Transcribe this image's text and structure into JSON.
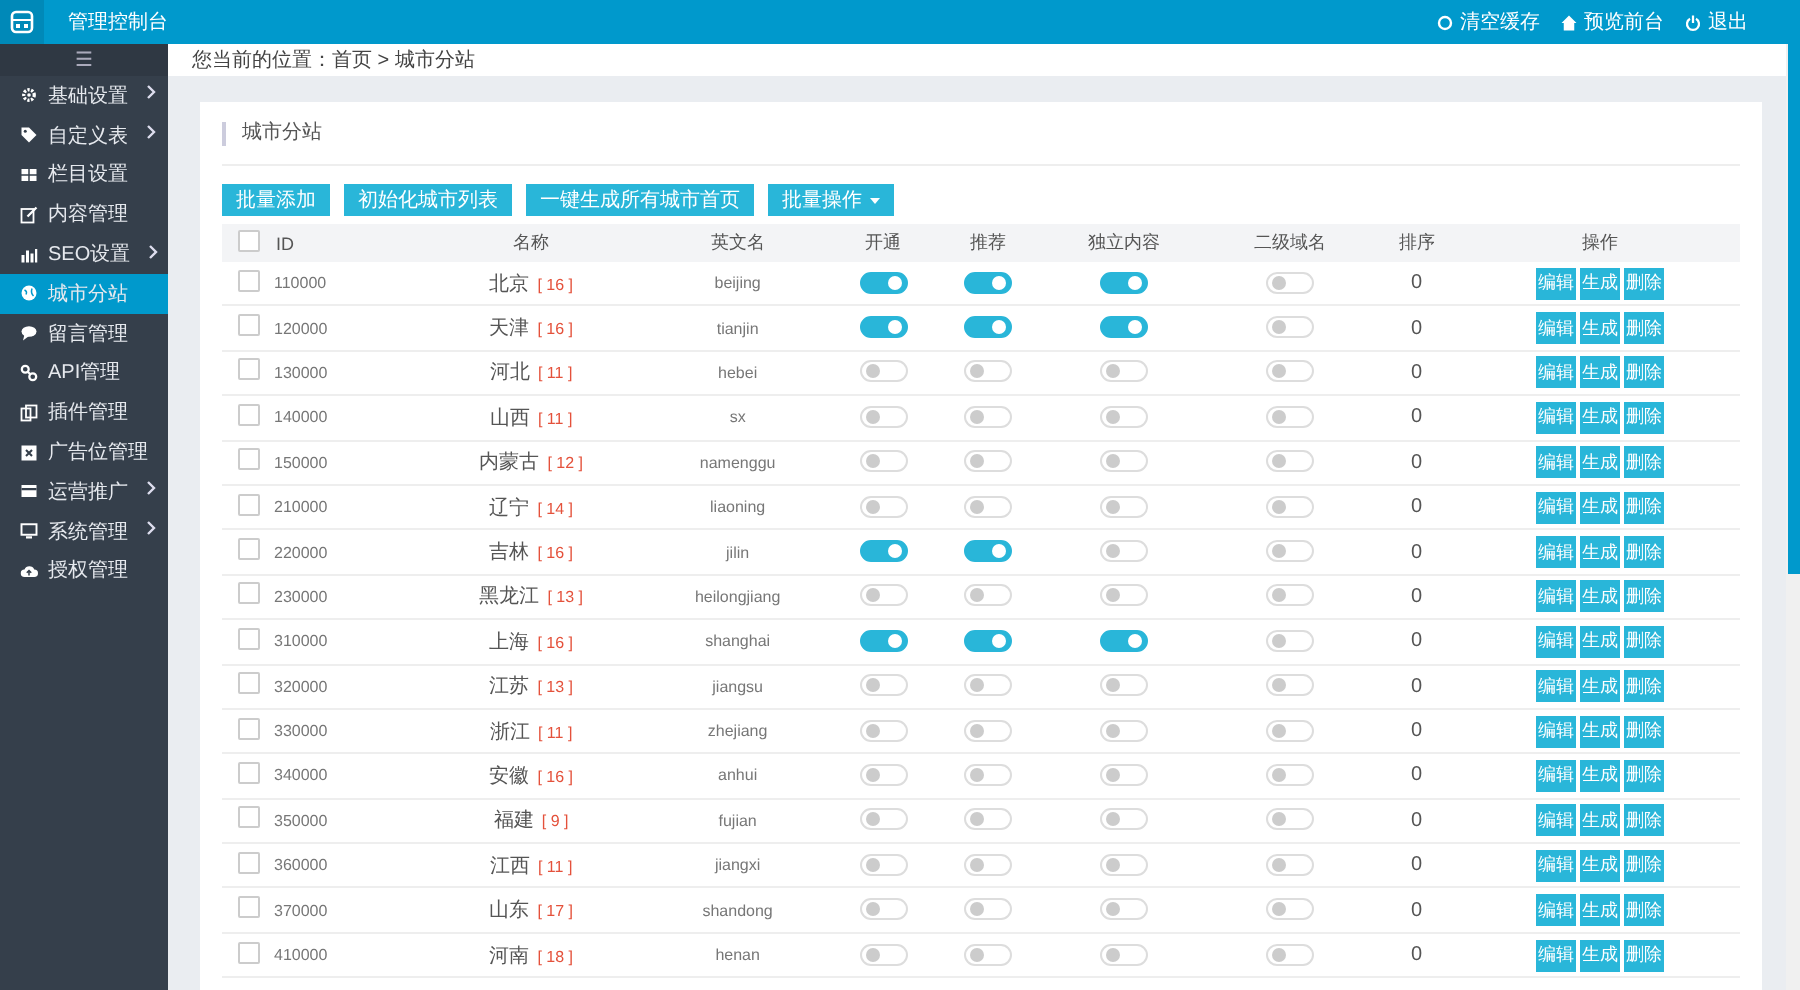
{
  "header": {
    "title": "管理控制台",
    "actions": [
      {
        "label": "清空缓存",
        "kind": "refresh"
      },
      {
        "label": "预览前台",
        "kind": "home"
      },
      {
        "label": "退出",
        "kind": "power"
      }
    ]
  },
  "sidebar": {
    "toggle": "☰",
    "items": [
      {
        "label": "基础设置",
        "kind": "gear",
        "expandable": true,
        "selected": false
      },
      {
        "label": "自定义表",
        "kind": "tag",
        "expandable": true,
        "selected": false
      },
      {
        "label": "栏目设置",
        "kind": "grid",
        "expandable": false,
        "selected": false
      },
      {
        "label": "内容管理",
        "kind": "edit",
        "expandable": false,
        "selected": false
      },
      {
        "label": "SEO设置",
        "kind": "chart",
        "expandable": true,
        "selected": false
      },
      {
        "label": "城市分站",
        "kind": "globe",
        "expandable": false,
        "selected": true
      },
      {
        "label": "留言管理",
        "kind": "chat",
        "expandable": false,
        "selected": false
      },
      {
        "label": "API管理",
        "kind": "link",
        "expandable": false,
        "selected": false
      },
      {
        "label": "插件管理",
        "kind": "copy",
        "expandable": false,
        "selected": false
      },
      {
        "label": "广告位管理",
        "kind": "close",
        "expandable": false,
        "selected": false
      },
      {
        "label": "运营推广",
        "kind": "card",
        "expandable": true,
        "selected": false
      },
      {
        "label": "系统管理",
        "kind": "monitor",
        "expandable": true,
        "selected": false
      },
      {
        "label": "授权管理",
        "kind": "cloud",
        "expandable": false,
        "selected": false
      }
    ]
  },
  "breadcrumb": "您当前的位置：首页 > 城市分站",
  "card": {
    "title": "城市分站",
    "buttons": [
      {
        "label": "批量添加",
        "dropdown": false
      },
      {
        "label": "初始化城市列表",
        "dropdown": false
      },
      {
        "label": "一键生成所有城市首页",
        "dropdown": false
      },
      {
        "label": "批量操作",
        "dropdown": true
      }
    ]
  },
  "table": {
    "select_all_checked": false,
    "columns": [
      "ID",
      "名称",
      "英文名",
      "开通",
      "推荐",
      "独立内容",
      "二级域名",
      "排序",
      "操作"
    ],
    "rows": [
      {
        "id": "110000",
        "name": "北京",
        "count": "[ 16 ]",
        "en": "beijing",
        "open": true,
        "recommend": true,
        "independent": true,
        "subdomain": false,
        "sort": "0",
        "checked": false,
        "actions": [
          "编辑",
          "生成",
          "删除"
        ]
      },
      {
        "id": "120000",
        "name": "天津",
        "count": "[ 16 ]",
        "en": "tianjin",
        "open": true,
        "recommend": true,
        "independent": true,
        "subdomain": false,
        "sort": "0",
        "checked": false,
        "actions": [
          "编辑",
          "生成",
          "删除"
        ]
      },
      {
        "id": "130000",
        "name": "河北",
        "count": "[ 11 ]",
        "en": "hebei",
        "open": false,
        "recommend": false,
        "independent": false,
        "subdomain": false,
        "sort": "0",
        "checked": false,
        "actions": [
          "编辑",
          "生成",
          "删除"
        ]
      },
      {
        "id": "140000",
        "name": "山西",
        "count": "[ 11 ]",
        "en": "sx",
        "open": false,
        "recommend": false,
        "independent": false,
        "subdomain": false,
        "sort": "0",
        "checked": false,
        "actions": [
          "编辑",
          "生成",
          "删除"
        ]
      },
      {
        "id": "150000",
        "name": "内蒙古",
        "count": "[ 12 ]",
        "en": "namenggu",
        "open": false,
        "recommend": false,
        "independent": false,
        "subdomain": false,
        "sort": "0",
        "checked": false,
        "actions": [
          "编辑",
          "生成",
          "删除"
        ]
      },
      {
        "id": "210000",
        "name": "辽宁",
        "count": "[ 14 ]",
        "en": "liaoning",
        "open": false,
        "recommend": false,
        "independent": false,
        "subdomain": false,
        "sort": "0",
        "checked": false,
        "actions": [
          "编辑",
          "生成",
          "删除"
        ]
      },
      {
        "id": "220000",
        "name": "吉林",
        "count": "[ 16 ]",
        "en": "jilin",
        "open": true,
        "recommend": true,
        "independent": false,
        "subdomain": false,
        "sort": "0",
        "checked": false,
        "actions": [
          "编辑",
          "生成",
          "删除"
        ]
      },
      {
        "id": "230000",
        "name": "黑龙江",
        "count": "[ 13 ]",
        "en": "heilongjiang",
        "open": false,
        "recommend": false,
        "independent": false,
        "subdomain": false,
        "sort": "0",
        "checked": false,
        "actions": [
          "编辑",
          "生成",
          "删除"
        ]
      },
      {
        "id": "310000",
        "name": "上海",
        "count": "[ 16 ]",
        "en": "shanghai",
        "open": true,
        "recommend": true,
        "independent": true,
        "subdomain": false,
        "sort": "0",
        "checked": false,
        "actions": [
          "编辑",
          "生成",
          "删除"
        ]
      },
      {
        "id": "320000",
        "name": "江苏",
        "count": "[ 13 ]",
        "en": "jiangsu",
        "open": false,
        "recommend": false,
        "independent": false,
        "subdomain": false,
        "sort": "0",
        "checked": false,
        "actions": [
          "编辑",
          "生成",
          "删除"
        ]
      },
      {
        "id": "330000",
        "name": "浙江",
        "count": "[ 11 ]",
        "en": "zhejiang",
        "open": false,
        "recommend": false,
        "independent": false,
        "subdomain": false,
        "sort": "0",
        "checked": false,
        "actions": [
          "编辑",
          "生成",
          "删除"
        ]
      },
      {
        "id": "340000",
        "name": "安徽",
        "count": "[ 16 ]",
        "en": "anhui",
        "open": false,
        "recommend": false,
        "independent": false,
        "subdomain": false,
        "sort": "0",
        "checked": false,
        "actions": [
          "编辑",
          "生成",
          "删除"
        ]
      },
      {
        "id": "350000",
        "name": "福建",
        "count": "[ 9 ]",
        "en": "fujian",
        "open": false,
        "recommend": false,
        "independent": false,
        "subdomain": false,
        "sort": "0",
        "checked": false,
        "actions": [
          "编辑",
          "生成",
          "删除"
        ]
      },
      {
        "id": "360000",
        "name": "江西",
        "count": "[ 11 ]",
        "en": "jiangxi",
        "open": false,
        "recommend": false,
        "independent": false,
        "subdomain": false,
        "sort": "0",
        "checked": false,
        "actions": [
          "编辑",
          "生成",
          "删除"
        ]
      },
      {
        "id": "370000",
        "name": "山东",
        "count": "[ 17 ]",
        "en": "shandong",
        "open": false,
        "recommend": false,
        "independent": false,
        "subdomain": false,
        "sort": "0",
        "checked": false,
        "actions": [
          "编辑",
          "生成",
          "删除"
        ]
      },
      {
        "id": "410000",
        "name": "河南",
        "count": "[ 18 ]",
        "en": "henan",
        "open": false,
        "recommend": false,
        "independent": false,
        "subdomain": false,
        "sort": "0",
        "checked": false,
        "actions": [
          "编辑",
          "生成",
          "删除"
        ]
      }
    ]
  }
}
